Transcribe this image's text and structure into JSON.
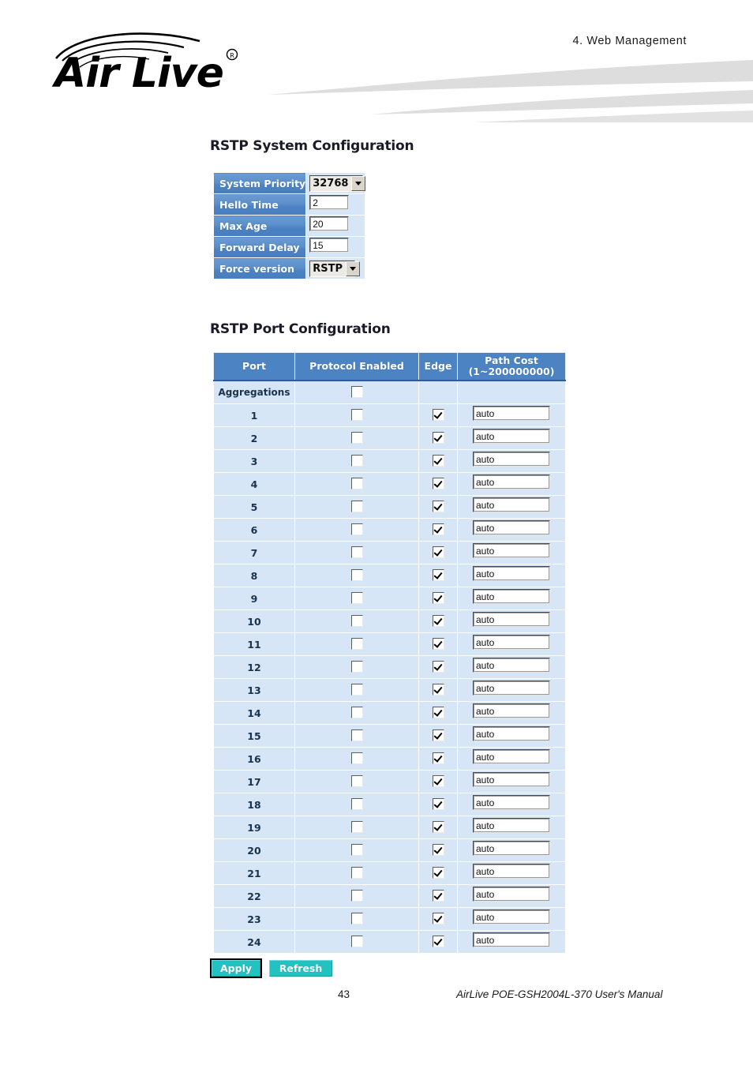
{
  "page": {
    "chapter_title": "4. Web Management",
    "brand": "AirLive",
    "brand_registered_mark": "®",
    "footer_page_number": "43",
    "footer_manual": "AirLive POE-GSH2004L-370 User's Manual",
    "colors": {
      "header_blue": "#4c83c3",
      "row_blue": "#d6e6f7",
      "button_teal": "#23c2c2",
      "swoosh_gray": "#dcdcdc"
    }
  },
  "system_config": {
    "title": "RSTP System Configuration",
    "rows": [
      {
        "label": "System Priority",
        "type": "select",
        "value": "32768"
      },
      {
        "label": "Hello Time",
        "type": "text",
        "value": "2"
      },
      {
        "label": "Max Age",
        "type": "text",
        "value": "20"
      },
      {
        "label": "Forward Delay",
        "type": "text",
        "value": "15"
      },
      {
        "label": "Force version",
        "type": "select",
        "value": "RSTP"
      }
    ]
  },
  "port_config": {
    "title": "RSTP Port Configuration",
    "columns": {
      "port": "Port",
      "protocol_enabled": "Protocol Enabled",
      "edge": "Edge",
      "path_cost_line1": "Path Cost",
      "path_cost_line2": "(1~200000000)"
    },
    "rows": [
      {
        "port": "Aggregations",
        "protocol_enabled": false,
        "edge": null,
        "path_cost": null
      },
      {
        "port": "1",
        "protocol_enabled": false,
        "edge": true,
        "path_cost": "auto"
      },
      {
        "port": "2",
        "protocol_enabled": false,
        "edge": true,
        "path_cost": "auto"
      },
      {
        "port": "3",
        "protocol_enabled": false,
        "edge": true,
        "path_cost": "auto"
      },
      {
        "port": "4",
        "protocol_enabled": false,
        "edge": true,
        "path_cost": "auto"
      },
      {
        "port": "5",
        "protocol_enabled": false,
        "edge": true,
        "path_cost": "auto"
      },
      {
        "port": "6",
        "protocol_enabled": false,
        "edge": true,
        "path_cost": "auto"
      },
      {
        "port": "7",
        "protocol_enabled": false,
        "edge": true,
        "path_cost": "auto"
      },
      {
        "port": "8",
        "protocol_enabled": false,
        "edge": true,
        "path_cost": "auto"
      },
      {
        "port": "9",
        "protocol_enabled": false,
        "edge": true,
        "path_cost": "auto"
      },
      {
        "port": "10",
        "protocol_enabled": false,
        "edge": true,
        "path_cost": "auto"
      },
      {
        "port": "11",
        "protocol_enabled": false,
        "edge": true,
        "path_cost": "auto"
      },
      {
        "port": "12",
        "protocol_enabled": false,
        "edge": true,
        "path_cost": "auto"
      },
      {
        "port": "13",
        "protocol_enabled": false,
        "edge": true,
        "path_cost": "auto"
      },
      {
        "port": "14",
        "protocol_enabled": false,
        "edge": true,
        "path_cost": "auto"
      },
      {
        "port": "15",
        "protocol_enabled": false,
        "edge": true,
        "path_cost": "auto"
      },
      {
        "port": "16",
        "protocol_enabled": false,
        "edge": true,
        "path_cost": "auto"
      },
      {
        "port": "17",
        "protocol_enabled": false,
        "edge": true,
        "path_cost": "auto"
      },
      {
        "port": "18",
        "protocol_enabled": false,
        "edge": true,
        "path_cost": "auto"
      },
      {
        "port": "19",
        "protocol_enabled": false,
        "edge": true,
        "path_cost": "auto"
      },
      {
        "port": "20",
        "protocol_enabled": false,
        "edge": true,
        "path_cost": "auto"
      },
      {
        "port": "21",
        "protocol_enabled": false,
        "edge": true,
        "path_cost": "auto"
      },
      {
        "port": "22",
        "protocol_enabled": false,
        "edge": true,
        "path_cost": "auto"
      },
      {
        "port": "23",
        "protocol_enabled": false,
        "edge": true,
        "path_cost": "auto"
      },
      {
        "port": "24",
        "protocol_enabled": false,
        "edge": true,
        "path_cost": "auto"
      }
    ]
  },
  "actions": {
    "apply_label": "Apply",
    "refresh_label": "Refresh"
  }
}
